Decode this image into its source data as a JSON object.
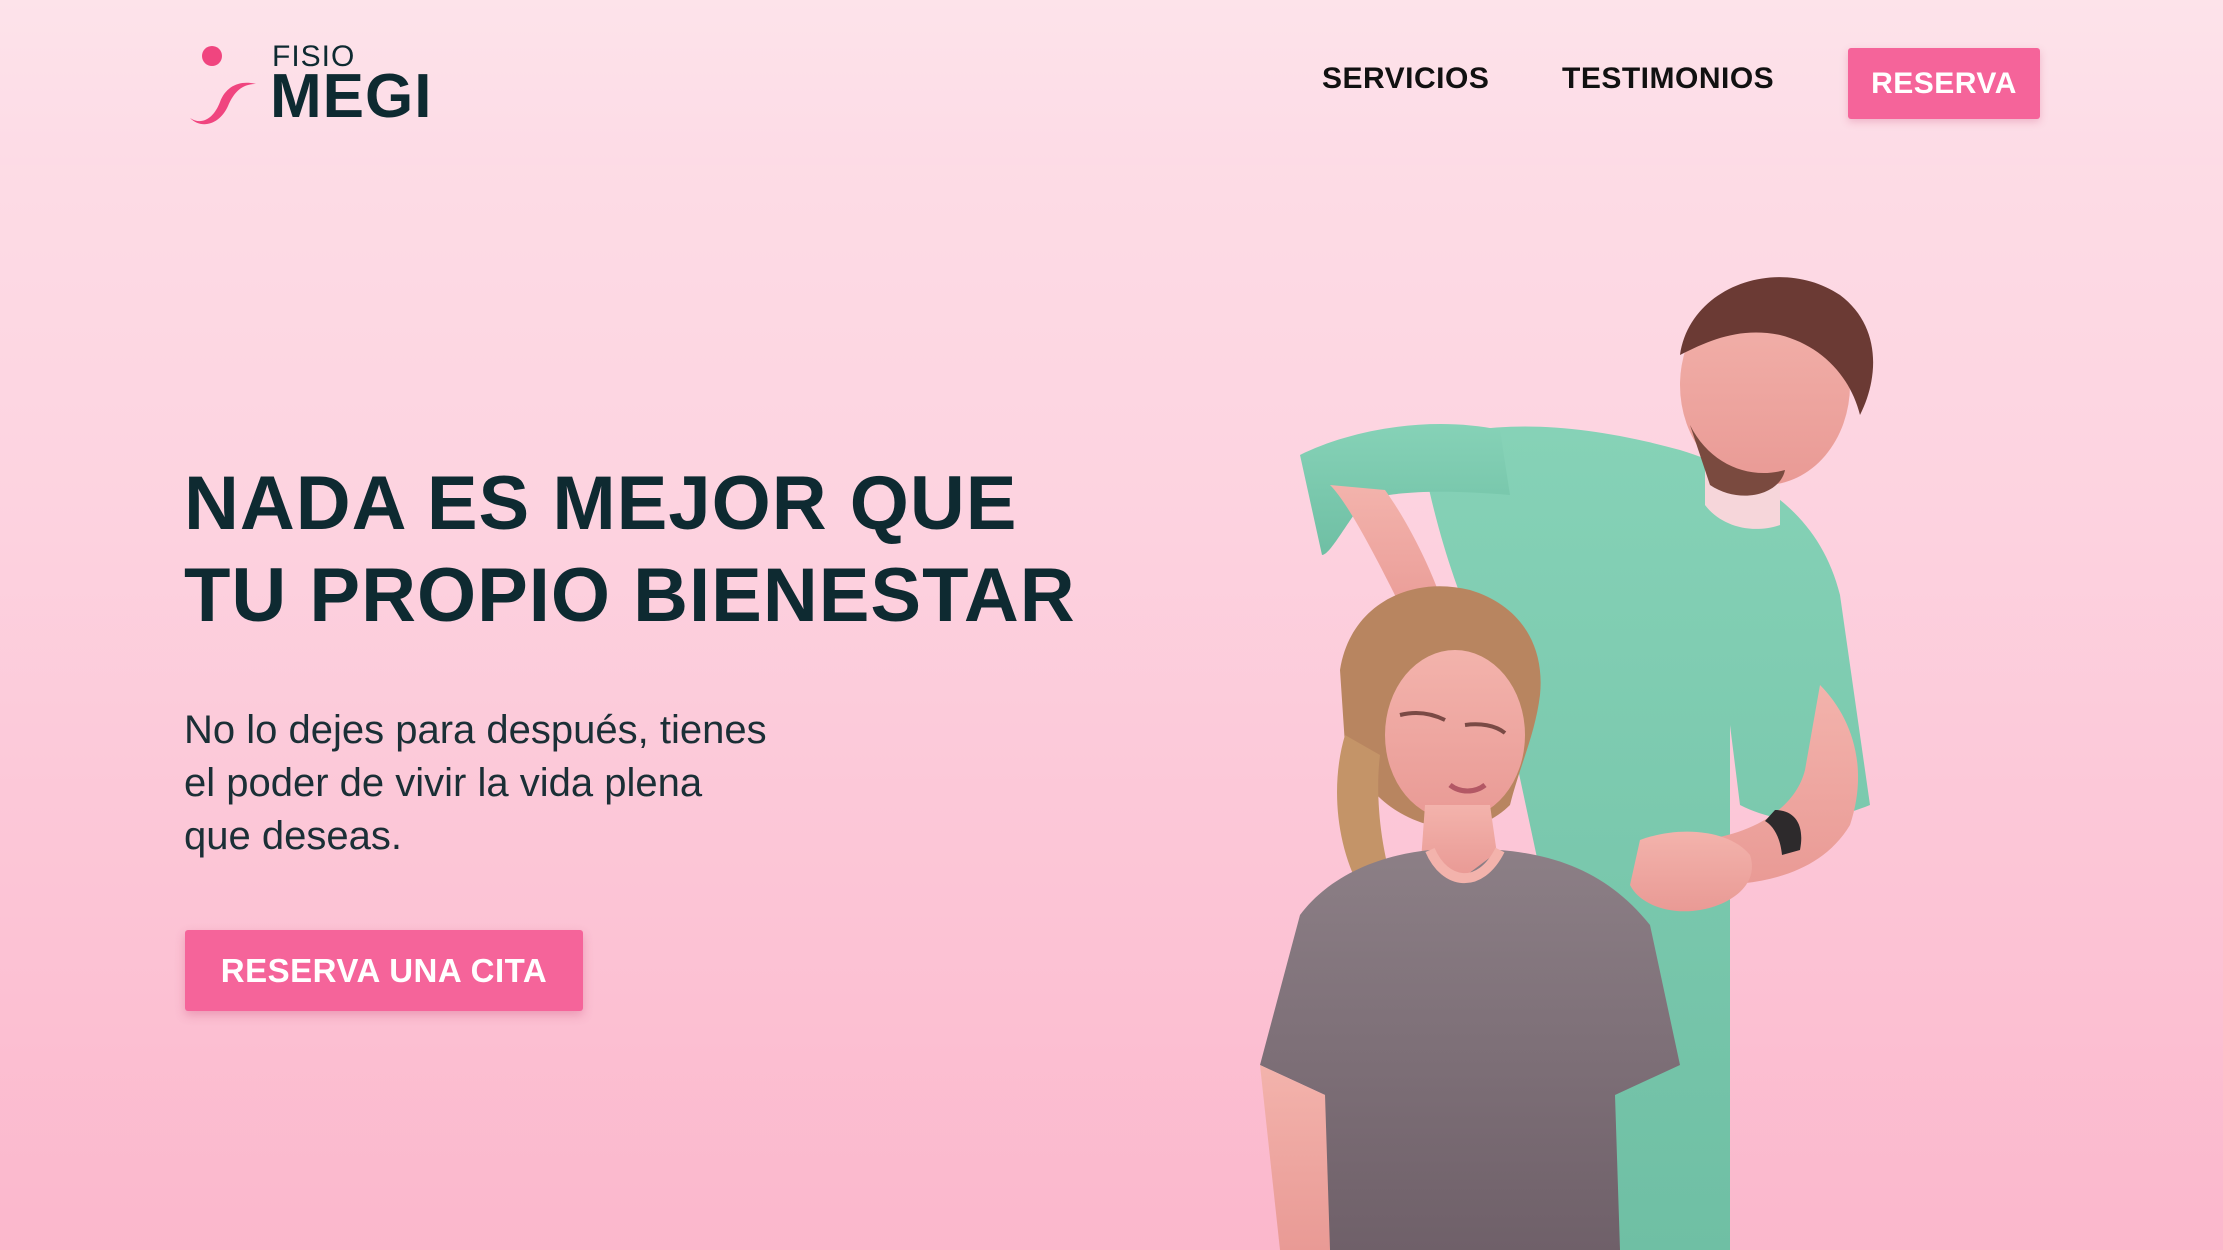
{
  "brand": {
    "name_small": "FISIO",
    "name_big": "MEGI",
    "accent_color": "#f5649a",
    "text_color": "#0e2a31"
  },
  "nav": {
    "links": [
      {
        "label": "SERVICIOS"
      },
      {
        "label": "TESTIMONIOS"
      }
    ],
    "cta_label": "RESERVA"
  },
  "hero": {
    "headline_lines": [
      "NADA ES MEJOR QUE",
      "TU PROPIO BIENESTAR"
    ],
    "sub_lines": [
      "No lo dejes para después, tienes",
      "el poder de vivir la vida plena",
      "que deseas."
    ],
    "cta_label": "RESERVA UNA CITA"
  },
  "image": {
    "subject": "physiotherapist-adjusting-patient-neck"
  }
}
